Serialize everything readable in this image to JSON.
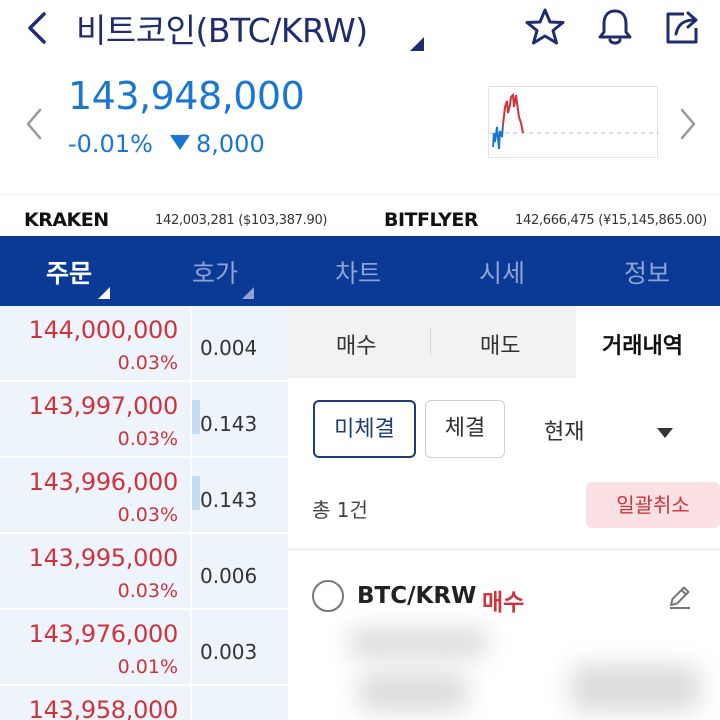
{
  "header": {
    "title": "비트코인(BTC/KRW)",
    "icons": [
      "back-arrow-icon",
      "star-icon",
      "bell-icon",
      "share-icon"
    ]
  },
  "ticker": {
    "price": "143,948,000",
    "change_pct": "-0.01%",
    "change_amount": "8,000",
    "change_direction": "down",
    "up_color": "#d0333c",
    "down_color": "#1976d2"
  },
  "exchanges": [
    {
      "name": "KRAKEN",
      "value": "142,003,281 ($103,387.90)"
    },
    {
      "name": "BITFLYER",
      "value": "142,666,475 (¥15,145,865.00)"
    }
  ],
  "tabs": [
    {
      "label": "주문",
      "active": true
    },
    {
      "label": "호가",
      "active": false
    },
    {
      "label": "차트",
      "active": false
    },
    {
      "label": "시세",
      "active": false
    },
    {
      "label": "정보",
      "active": false
    }
  ],
  "orderbook": [
    {
      "price": "144,000,000",
      "pct": "0.03%",
      "qty": "0.004",
      "depth": 0.0
    },
    {
      "price": "143,997,000",
      "pct": "0.03%",
      "qty": "0.143",
      "depth": 0.08
    },
    {
      "price": "143,996,000",
      "pct": "0.03%",
      "qty": "0.143",
      "depth": 0.08
    },
    {
      "price": "143,995,000",
      "pct": "0.03%",
      "qty": "0.006",
      "depth": 0.0
    },
    {
      "price": "143,976,000",
      "pct": "0.01%",
      "qty": "0.003",
      "depth": 0.0
    },
    {
      "price": "143,958,000",
      "pct": "",
      "qty": "",
      "depth": 0.0
    }
  ],
  "panel": {
    "sub_tabs": [
      {
        "label": "매수",
        "active": false
      },
      {
        "label": "매도",
        "active": false
      },
      {
        "label": "거래내역",
        "active": true
      }
    ],
    "filters": {
      "unfilled": "미체결",
      "filled": "체결",
      "current": "현재"
    },
    "count_text": "총 1건",
    "cancel_all": "일괄취소",
    "order": {
      "pair": "BTC/KRW",
      "side": "매수"
    }
  },
  "colors": {
    "brand_navy": "#0a3a96",
    "title_navy": "#1f2c6e",
    "price_blue": "#1976d2",
    "sell_red": "#d0333c"
  }
}
